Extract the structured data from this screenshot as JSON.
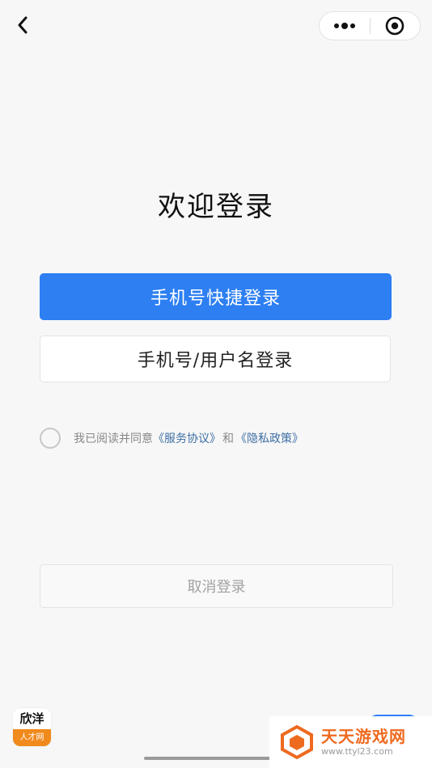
{
  "nav": {
    "back_icon": "chevron-left-icon",
    "menu_icon": "more-dots-icon",
    "close_icon": "target-circle-icon"
  },
  "page": {
    "title": "欢迎登录"
  },
  "actions": {
    "quick_login_label": "手机号快捷登录",
    "account_login_label": "手机号/用户名登录",
    "cancel_label": "取消登录"
  },
  "agreement": {
    "prefix": "我已阅读并同意",
    "service_link": "《服务协议》",
    "conjunction": "和",
    "privacy_link": "《隐私政策》"
  },
  "brand": {
    "logo_top": "欣洋",
    "logo_bottom": "人才网"
  },
  "watermark": {
    "title": "天天游戏网",
    "url": "www.ttyl23.com"
  },
  "colors": {
    "primary": "#2d7ff2",
    "link": "#3d6fa5",
    "logo_accent": "#f08a1c",
    "watermark": "#ee6a1f"
  }
}
